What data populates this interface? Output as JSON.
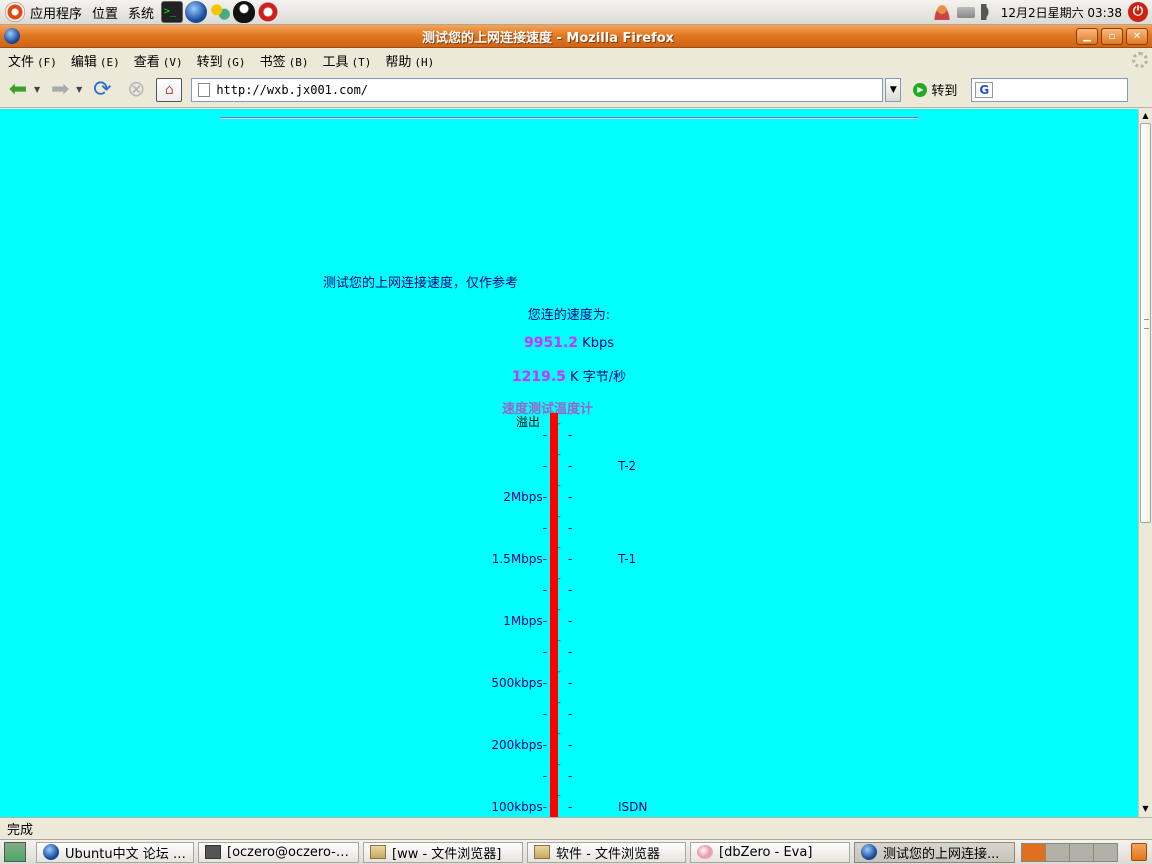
{
  "top_panel": {
    "menus": [
      "应用程序",
      "位置",
      "系统"
    ],
    "clock": "12月2日星期六 03:38"
  },
  "window": {
    "title": "测试您的上网连接速度 - Mozilla Firefox"
  },
  "menubar": [
    {
      "label": "文件",
      "accel": "(F)"
    },
    {
      "label": "编辑",
      "accel": "(E)"
    },
    {
      "label": "查看",
      "accel": "(V)"
    },
    {
      "label": "转到",
      "accel": "(G)"
    },
    {
      "label": "书签",
      "accel": "(B)"
    },
    {
      "label": "工具",
      "accel": "(T)"
    },
    {
      "label": "帮助",
      "accel": "(H)"
    }
  ],
  "navbar": {
    "url": "http://wxb.jx001.com/",
    "go_label": "转到",
    "search_engine_letter": "G",
    "search_value": ""
  },
  "page": {
    "heading": "测试您的上网连接速度，仅作参考",
    "speed_label": "您连的速度为:",
    "kbps_value": "9951.2",
    "kbps_unit": " Kbps",
    "kbytes_value": "1219.5",
    "kbytes_unit": " K 字节/秒",
    "gauge_title": "速度测试温度计",
    "overflow_label": "溢出",
    "scale_labels": [
      "2Mbps-",
      "1.5Mbps-",
      "1Mbps-",
      "500kbps-",
      "200kbps-",
      "100kbps-"
    ],
    "line_labels": [
      "T-2",
      "T-1",
      "ISDN"
    ],
    "accent_color": "#cc33ff",
    "background_color": "#00ffff",
    "bar_color": "#ff0000"
  },
  "statusbar": {
    "text": "完成"
  },
  "taskbar": {
    "tasks": [
      {
        "label": "Ubuntu中文 论坛 …",
        "icon": "globe-icon"
      },
      {
        "label": "[oczero@oczero-…",
        "icon": "terminal-icon"
      },
      {
        "label": "[ww - 文件浏览器]",
        "icon": "folder-icon"
      },
      {
        "label": "软件 - 文件浏览器",
        "icon": "folder-icon"
      },
      {
        "label": "[dbZero - Eva]",
        "icon": "eva-icon"
      },
      {
        "label": "测试您的上网连接...",
        "icon": "globe-icon"
      }
    ]
  }
}
